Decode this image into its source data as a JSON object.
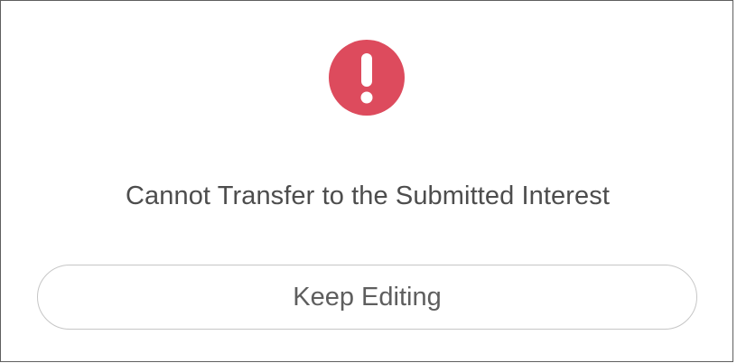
{
  "dialog": {
    "icon": "exclamation-circle-icon",
    "message": "Cannot Transfer to the Submitted Interest",
    "button_label": "Keep Editing"
  },
  "colors": {
    "accent": "#dd4b5d",
    "text": "#4d4d4d",
    "button_text": "#5e5e5e",
    "button_border": "#c6c6c6"
  }
}
